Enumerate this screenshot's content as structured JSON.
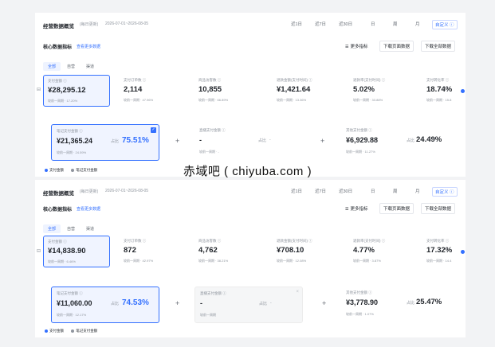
{
  "watermark": "赤域吧 ( chiyuba.com )",
  "panels": [
    {
      "title": "经营数据概览",
      "tag": "(每日更新)",
      "date_range": "2026-07-01~2026-08-05",
      "ranges": [
        "近1日",
        "近7日",
        "近30日",
        "日",
        "周",
        "月",
        "自定义 ⓘ"
      ],
      "sub_title": "核心数据指标",
      "sub_link": "查看更多数据",
      "actions": [
        "更多指标",
        "下载页面数据",
        "下载全部数据"
      ],
      "segments": [
        "全部",
        "自营",
        "渠道"
      ],
      "kpis": [
        {
          "label": "支付金额 ⓘ",
          "value": "¥28,295.12",
          "foot": "较前一周期 · 17.20%"
        },
        {
          "label": "支付订单数 ⓘ",
          "value": "2,114",
          "foot": "较前一周期 · 47.96%"
        },
        {
          "label": "商品访客数 ⓘ",
          "value": "10,855",
          "foot": "较前一周期 · 66.89%"
        },
        {
          "label": "退款金额(支付时间) ⓘ",
          "value": "¥1,421.64",
          "foot": "较前一周期 · 13.36%"
        },
        {
          "label": "退款率(支付时间) ⓘ",
          "value": "5.02%",
          "foot": "较前一周期 · 33.88%"
        },
        {
          "label": "支付转化率 ⓘ",
          "value": "18.74%",
          "foot": "较前一周期 · 15.8"
        }
      ],
      "funnel": [
        {
          "label": "笔记支付金额 ⓘ",
          "value": "¥21,365.24",
          "foot": "较前一周期 · 24.59%",
          "ratio_label": "占比",
          "ratio": "75.51%"
        },
        {
          "label": "直播支付金额 ⓘ",
          "value": "-",
          "foot": "较前一周期 · -",
          "ratio_label": "占比",
          "ratio": "-"
        },
        {
          "label": "其他支付金额 ⓘ",
          "value": "¥6,929.88",
          "foot": "较前一周期 · 11.27%",
          "ratio_label": "占比",
          "ratio": "24.49%"
        }
      ],
      "legend": [
        "支付金额",
        "笔记支付金额"
      ]
    },
    {
      "title": "经营数据概览",
      "tag": "(每日更新)",
      "date_range": "2026-07-01~2026-08-05",
      "ranges": [
        "近1日",
        "近7日",
        "近30日",
        "日",
        "周",
        "月",
        "自定义 ⓘ"
      ],
      "sub_title": "核心数据指标",
      "sub_link": "查看更多数据",
      "actions": [
        "更多指标",
        "下载页面数据",
        "下载全部数据"
      ],
      "segments": [
        "全部",
        "自营",
        "渠道"
      ],
      "kpis": [
        {
          "label": "支付金额 ⓘ",
          "value": "¥14,838.90",
          "foot": "较前一周期 · 6.46%"
        },
        {
          "label": "支付订单数 ⓘ",
          "value": "872",
          "foot": "较前一周期 · 42.97%"
        },
        {
          "label": "商品访客数 ⓘ",
          "value": "4,762",
          "foot": "较前一周期 · 38.21%"
        },
        {
          "label": "退款金额(支付时间) ⓘ",
          "value": "¥708.10",
          "foot": "较前一周期 · 12.08%"
        },
        {
          "label": "退款率(支付时间) ⓘ",
          "value": "4.77%",
          "foot": "较前一周期 · 3.87%"
        },
        {
          "label": "支付转化率 ⓘ",
          "value": "17.32%",
          "foot": "较前一周期 · 14.4"
        }
      ],
      "funnel": [
        {
          "label": "笔记支付金额 ⓘ",
          "value": "¥11,060.00",
          "foot": "较前一周期 · 12.17%",
          "ratio_label": "占比",
          "ratio": "74.53%"
        },
        {
          "label": "直播支付金额 ⓘ",
          "value": "-",
          "foot": "较前一周期",
          "ratio_label": "占比",
          "ratio": "-"
        },
        {
          "label": "其他支付金额 ⓘ",
          "value": "¥3,778.90",
          "foot": "较前一周期 · 1.07%",
          "ratio_label": "占比",
          "ratio": "25.47%"
        }
      ],
      "legend": [
        "支付金额",
        "笔记支付金额"
      ]
    }
  ]
}
